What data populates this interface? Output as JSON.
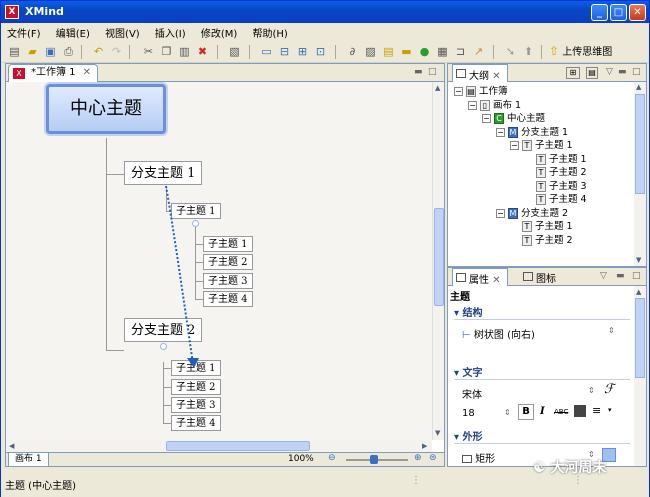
{
  "window": {
    "title": "XMind",
    "app_icon": "X"
  },
  "menu": [
    "文件(F)",
    "编辑(E)",
    "视图(V)",
    "插入(I)",
    "修改(M)",
    "帮助(H)"
  ],
  "toolbar": {
    "upload_label": "上传思维图"
  },
  "editor": {
    "tab_label": "*工作簿 1",
    "sheet_tab": "画布 1",
    "zoom": "100%",
    "central_topic": "中心主题",
    "branches": [
      {
        "label": "分支主题 1",
        "children": [
          "子主题 1"
        ],
        "grandchildren": [
          "子主题 1",
          "子主题 2",
          "子主题 3",
          "子主题 4"
        ]
      },
      {
        "label": "分支主题 2",
        "children": [
          "子主题 1",
          "子主题 2",
          "子主题 3",
          "子主题 4"
        ]
      }
    ]
  },
  "outline": {
    "title": "大纲",
    "rows": [
      {
        "label": "工作簿",
        "icon": "folder-icon",
        "level": 0,
        "expanded": true
      },
      {
        "label": "画布 1",
        "icon": "sheet-icon",
        "level": 1,
        "expanded": true
      },
      {
        "label": "中心主题",
        "icon": "C",
        "level": 2,
        "expanded": true
      },
      {
        "label": "分支主题 1",
        "icon": "M",
        "level": 3,
        "expanded": true
      },
      {
        "label": "子主题 1",
        "icon": "T",
        "level": 4,
        "expanded": true
      },
      {
        "label": "子主题 1",
        "icon": "T",
        "level": 5
      },
      {
        "label": "子主题 2",
        "icon": "T",
        "level": 5
      },
      {
        "label": "子主题 3",
        "icon": "T",
        "level": 5
      },
      {
        "label": "子主题 4",
        "icon": "T",
        "level": 5
      },
      {
        "label": "分支主题 2",
        "icon": "M",
        "level": 3,
        "expanded": true
      },
      {
        "label": "子主题 1",
        "icon": "T",
        "level": 4
      },
      {
        "label": "子主题 2",
        "icon": "T",
        "level": 4
      }
    ]
  },
  "properties": {
    "tab_props": "属性",
    "tab_icons": "图标",
    "heading": "主题",
    "sec_structure": "结构",
    "structure_value": "树状图 (向右)",
    "sec_text": "文字",
    "font": "宋体",
    "font_size": "18",
    "bold": "B",
    "italic": "I",
    "strike": "ABC",
    "sec_shape": "外形",
    "shape_value": "矩形"
  },
  "status": {
    "text": "主题 (中心主题)"
  },
  "watermark": "大河周末",
  "colors": {
    "accent": "#6c8fd6",
    "dotted_arrow": "#1f5fbf",
    "section_title": "#21408a"
  }
}
